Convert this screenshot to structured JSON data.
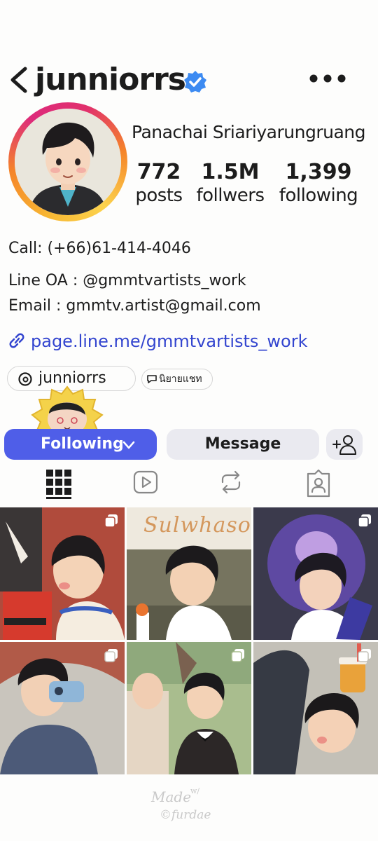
{
  "header": {
    "username": "junniorrs"
  },
  "profile": {
    "full_name": "Panachai Sriariyarungruang",
    "stats": {
      "posts_count": "772",
      "posts_label": "posts",
      "followers_count": "1.5M",
      "followers_label": "follwers",
      "following_count": "1,399",
      "following_label": "following"
    }
  },
  "bio": {
    "call": "Call: (+66)61-414-4046",
    "line_oa": "Line OA : @gmmtvartists_work",
    "email": "Email : gmmtv.artist@gmail.com",
    "link": "page.line.me/gmmtvartists_work"
  },
  "chips": {
    "threads_handle": "junniorrs",
    "chat_label": "นิยายแชท"
  },
  "actions": {
    "following_label": "Following",
    "message_label": "Message"
  },
  "tabs": [
    "grid-icon",
    "reels-icon",
    "reposts-icon",
    "tagged-icon"
  ],
  "posts": {
    "tile_2_text": "Sulwhasoo"
  },
  "watermark": "Made w/ ©furdae",
  "colors": {
    "accent": "#4f5ee8",
    "link": "#3345cf",
    "verified": "#3d8bf2",
    "secondary_button": "#eaeaf0"
  }
}
